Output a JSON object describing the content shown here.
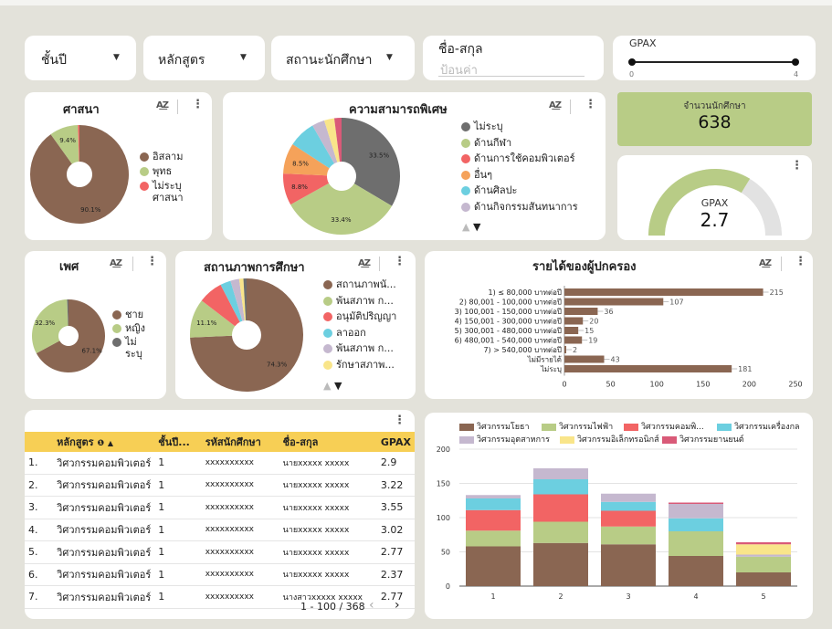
{
  "filters": {
    "year": {
      "label": "ชั้นปี"
    },
    "curriculum": {
      "label": "หลักสูตร"
    },
    "status": {
      "label": "สถานะนักศึกษา"
    },
    "name": {
      "label": "ชื่อ-สกุล",
      "placeholder": "ป้อนค่า"
    },
    "gpax": {
      "label": "GPAX",
      "min": "0",
      "max": "4"
    }
  },
  "kpi": {
    "label": "จำนวนนักศึกษา",
    "value": "638"
  },
  "gauge": {
    "label": "GPAX",
    "value": "2.7",
    "fraction": 0.675
  },
  "icons": {
    "az": "sort-az-icon",
    "more": "more-vert-icon",
    "dropdown": "caret-down-icon"
  },
  "chart_data": [
    {
      "id": "religion",
      "type": "pie",
      "title": "ศาสนา",
      "labels": [
        "อิสลาม",
        "พุทธ",
        "ไม่ระบุศาสนา"
      ],
      "legend_lines": [
        [
          "อิสลาม"
        ],
        [
          "พุทธ"
        ],
        [
          "ไม่ระบุ",
          "ศาสนา"
        ]
      ],
      "values": [
        90.1,
        9.4,
        0.5
      ],
      "data_labels": [
        "90.1%",
        "9.4%",
        ""
      ],
      "colors": [
        "#8a6652",
        "#b8cc86",
        "#f26464"
      ],
      "legend": "right"
    },
    {
      "id": "ability",
      "type": "pie",
      "title": "ความสามารถพิเศษ",
      "labels": [
        "ไม่ระบุ",
        "ด้านกีฬา",
        "ด้านการใช้คอมพิวเตอร์",
        "อื่นๆ",
        "ด้านศิลปะ",
        "ด้านกิจกรรมสันทนาการ"
      ],
      "values": [
        33.5,
        33.4,
        8.8,
        8.5,
        7.5,
        3.5,
        2.8,
        2.0
      ],
      "slice_colors": [
        "#6e6e6e",
        "#b8cc86",
        "#f26464",
        "#f5a25a",
        "#6ccfe0",
        "#c5b8cf",
        "#f9e58a",
        "#d95a78"
      ],
      "data_labels": [
        "33.5%",
        "33.4%",
        "8.8%",
        "8.5%",
        "",
        "",
        "",
        ""
      ],
      "colors": [
        "#6e6e6e",
        "#b8cc86",
        "#f26464",
        "#f5a25a",
        "#6ccfe0",
        "#c5b8cf"
      ],
      "legend": "right"
    },
    {
      "id": "gender",
      "type": "pie",
      "title": "เพศ",
      "labels": [
        "ชาย",
        "หญิง",
        "ไม่ระบุ"
      ],
      "legend_lines": [
        [
          "ชาย"
        ],
        [
          "หญิง"
        ],
        [
          "ไม่",
          "ระบุ"
        ]
      ],
      "values": [
        67.1,
        32.3,
        0.6
      ],
      "data_labels": [
        "67.1%",
        "32.3%",
        ""
      ],
      "colors": [
        "#8a6652",
        "#b8cc86",
        "#6e6e6e"
      ],
      "legend": "right"
    },
    {
      "id": "status",
      "type": "pie",
      "title": "สถานภาพการศึกษา",
      "labels": [
        "สถานภาพนั...",
        "พ้นสภาพ ก...",
        "อนุมัติปริญญา",
        "ลาออก",
        "พ้นสภาพ ก...",
        "รักษาสภาพ..."
      ],
      "values": [
        74.3,
        11.1,
        7.0,
        3.0,
        2.5,
        1.2,
        0.9
      ],
      "slice_colors": [
        "#8a6652",
        "#b8cc86",
        "#f26464",
        "#6ccfe0",
        "#c5b8cf",
        "#f9e58a",
        "#6e6e6e"
      ],
      "data_labels": [
        "74.3%",
        "11.1%",
        "",
        "",
        "",
        "",
        ""
      ],
      "colors": [
        "#8a6652",
        "#b8cc86",
        "#f26464",
        "#6ccfe0",
        "#c5b8cf",
        "#f9e58a"
      ],
      "legend": "right"
    },
    {
      "id": "income",
      "type": "bar",
      "orientation": "horizontal",
      "title": "รายได้ของผู้ปกครอง",
      "categories": [
        "1) ≤ 80,000 บาทต่อปี",
        "2) 80,001 - 100,000 บาทต่อปี",
        "3) 100,001 - 150,000 บาทต่อปี",
        "4) 150,001 - 300,000 บาทต่อปี",
        "5) 300,001 - 480,000 บาทต่อปี",
        "6) 480,001 - 540,000 บาทต่อปี",
        "7) > 540,000 บาทต่อปี",
        "ไม่มีรายได้",
        "ไม่ระบุ"
      ],
      "values": [
        215,
        107,
        36,
        20,
        15,
        19,
        2,
        43,
        181
      ],
      "xlim": [
        0,
        250
      ],
      "ticks": [
        0,
        50,
        100,
        150,
        200,
        250
      ],
      "color": "#8a6652"
    },
    {
      "id": "by_year",
      "type": "bar",
      "stacked": true,
      "categories": [
        "1",
        "2",
        "3",
        "4",
        "5"
      ],
      "series": [
        {
          "name": "วิศวกรรมโยธา",
          "color": "#8a6652",
          "values": [
            58,
            63,
            61,
            44,
            20
          ]
        },
        {
          "name": "วิศวกรรมไฟฟ้า",
          "color": "#b8cc86",
          "values": [
            23,
            31,
            26,
            36,
            23
          ]
        },
        {
          "name": "วิศวกรรมคอมพิ...",
          "color": "#f26464",
          "values": [
            30,
            40,
            23,
            0,
            0
          ]
        },
        {
          "name": "วิศวกรรมเครื่องกล",
          "color": "#6ccfe0",
          "values": [
            17,
            22,
            13,
            19,
            0
          ]
        },
        {
          "name": "วิศวกรรมอุตสาหการ",
          "color": "#c5b8cf",
          "values": [
            5,
            16,
            12,
            21,
            3
          ]
        },
        {
          "name": "วิศวกรรมอิเล็กทรอนิกส์",
          "color": "#f9e58a",
          "values": [
            0,
            0,
            0,
            0,
            15
          ]
        },
        {
          "name": "วิศวกรรมยานยนต์",
          "color": "#d95a78",
          "values": [
            0,
            0,
            0,
            2,
            3
          ]
        }
      ],
      "ylim": [
        0,
        200
      ],
      "ticks": [
        0,
        50,
        100,
        150,
        200
      ],
      "legend": "top"
    }
  ],
  "table": {
    "headers": [
      "หลักสูตร",
      "ชั้นปี...",
      "รหัสนักศึกษา",
      "ชื่อ-สกุล",
      "GPAX"
    ],
    "rows": [
      {
        "n": "1.",
        "curriculum": "วิศวกรรมคอมพิวเตอร์",
        "year": "1",
        "id": "xxxxxxxxxx",
        "name": "นายxxxxx xxxxx",
        "gpax": "2.9"
      },
      {
        "n": "2.",
        "curriculum": "วิศวกรรมคอมพิวเตอร์",
        "year": "1",
        "id": "xxxxxxxxxx",
        "name": "นายxxxxx xxxxx",
        "gpax": "3.22"
      },
      {
        "n": "3.",
        "curriculum": "วิศวกรรมคอมพิวเตอร์",
        "year": "1",
        "id": "xxxxxxxxxx",
        "name": "นายxxxxx xxxxx",
        "gpax": "3.55"
      },
      {
        "n": "4.",
        "curriculum": "วิศวกรรมคอมพิวเตอร์",
        "year": "1",
        "id": "xxxxxxxxxx",
        "name": "นายxxxxx xxxxx",
        "gpax": "3.02"
      },
      {
        "n": "5.",
        "curriculum": "วิศวกรรมคอมพิวเตอร์",
        "year": "1",
        "id": "xxxxxxxxxx",
        "name": "นายxxxxx xxxxx",
        "gpax": "2.77"
      },
      {
        "n": "6.",
        "curriculum": "วิศวกรรมคอมพิวเตอร์",
        "year": "1",
        "id": "xxxxxxxxxx",
        "name": "นายxxxxx xxxxx",
        "gpax": "2.37"
      },
      {
        "n": "7.",
        "curriculum": "วิศวกรรมคอมพิวเตอร์",
        "year": "1",
        "id": "xxxxxxxxxx",
        "name": "นางสาวxxxxx xxxxx",
        "gpax": "2.77"
      }
    ],
    "pagination": "1 - 100 / 368"
  }
}
